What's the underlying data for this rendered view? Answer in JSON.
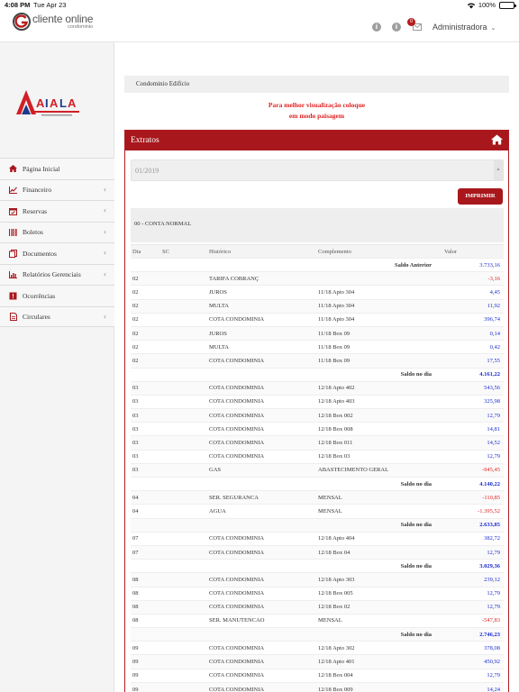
{
  "status": {
    "time": "4:08 PM",
    "date": "Tue Apr 23",
    "battery": "100%"
  },
  "header": {
    "brand": "cliente online",
    "brand_sub": "condominio",
    "notification_count": "0",
    "user": "Administradora"
  },
  "sidebar": {
    "items": [
      {
        "label": "Página Inicial",
        "icon": "home-icon"
      },
      {
        "label": "Financeiro",
        "icon": "chart-line-icon"
      },
      {
        "label": "Reservas",
        "icon": "calendar-icon"
      },
      {
        "label": "Boletos",
        "icon": "barcode-icon"
      },
      {
        "label": "Documentos",
        "icon": "documents-icon"
      },
      {
        "label": "Relatórios Gerenciais",
        "icon": "bar-chart-icon"
      },
      {
        "label": "Ocorrências",
        "icon": "warning-icon"
      },
      {
        "label": "Circulares",
        "icon": "file-icon"
      }
    ]
  },
  "main": {
    "breadcrumb": "Condominio Edifício",
    "notice_line1": "Para melhor visualização coloque",
    "notice_line2": "em modo paisagem",
    "panel_title": "Extratos",
    "period": "01/2019",
    "print_label": "IMPRIMIR",
    "account": "00 - CONTA NORMAL",
    "columns": {
      "dia": "Dia",
      "sc": "SC",
      "historico": "Histórico",
      "complemento": "Complemento",
      "valor": "Valor"
    },
    "saldo_anterior_label": "Saldo Anterior",
    "saldo_anterior_value": "3.733,16",
    "rows": [
      {
        "type": "entry",
        "dia": "02",
        "historico": "TARIFA COBRANÇ",
        "complemento": "",
        "valor": "-3,16",
        "neg": true
      },
      {
        "type": "entry",
        "dia": "02",
        "historico": "JUROS",
        "complemento": "11/18 Apto 304",
        "valor": "4,45",
        "neg": false
      },
      {
        "type": "entry",
        "dia": "02",
        "historico": "MULTA",
        "complemento": "11/18 Apto 304",
        "valor": "11,92",
        "neg": false
      },
      {
        "type": "entry",
        "dia": "02",
        "historico": "COTA CONDOMINIA",
        "complemento": "11/18 Apto 304",
        "valor": "396,74",
        "neg": false
      },
      {
        "type": "entry",
        "dia": "02",
        "historico": "JUROS",
        "complemento": "11/18 Box 09",
        "valor": "0,14",
        "neg": false
      },
      {
        "type": "entry",
        "dia": "02",
        "historico": "MULTA",
        "complemento": "11/18 Box 09",
        "valor": "0,42",
        "neg": false
      },
      {
        "type": "entry",
        "dia": "02",
        "historico": "COTA CONDOMINIA",
        "complemento": "11/18 Box 09",
        "valor": "17,55",
        "neg": false
      },
      {
        "type": "saldo",
        "label": "Saldo no dia",
        "valor": "4.161,22"
      },
      {
        "type": "entry",
        "dia": "03",
        "historico": "COTA CONDOMINIA",
        "complemento": "12/18 Apto 402",
        "valor": "543,56",
        "neg": false
      },
      {
        "type": "entry",
        "dia": "03",
        "historico": "COTA CONDOMINIA",
        "complemento": "12/18 Apto 403",
        "valor": "325,98",
        "neg": false
      },
      {
        "type": "entry",
        "dia": "03",
        "historico": "COTA CONDOMINIA",
        "complemento": "12/18 Box 002",
        "valor": "12,79",
        "neg": false
      },
      {
        "type": "entry",
        "dia": "03",
        "historico": "COTA CONDOMINIA",
        "complemento": "12/18 Box 008",
        "valor": "14,81",
        "neg": false
      },
      {
        "type": "entry",
        "dia": "03",
        "historico": "COTA CONDOMINIA",
        "complemento": "12/18 Box 011",
        "valor": "14,52",
        "neg": false
      },
      {
        "type": "entry",
        "dia": "03",
        "historico": "COTA CONDOMINIA",
        "complemento": "12/18 Box 03",
        "valor": "12,79",
        "neg": false
      },
      {
        "type": "entry",
        "dia": "03",
        "historico": "GAS",
        "complemento": "ABASTECIMENTO GERAL",
        "valor": "-945,45",
        "neg": true
      },
      {
        "type": "saldo",
        "label": "Saldo no dia",
        "valor": "4.140,22"
      },
      {
        "type": "entry",
        "dia": "04",
        "historico": "SER. SEGURANCA",
        "complemento": "MENSAL",
        "valor": "-110,85",
        "neg": true
      },
      {
        "type": "entry",
        "dia": "04",
        "historico": "AGUA",
        "complemento": "MENSAL",
        "valor": "-1.395,52",
        "neg": true
      },
      {
        "type": "saldo",
        "label": "Saldo no dia",
        "valor": "2.633,85"
      },
      {
        "type": "entry",
        "dia": "07",
        "historico": "COTA CONDOMINIA",
        "complemento": "12/18 Apto 404",
        "valor": "382,72",
        "neg": false
      },
      {
        "type": "entry",
        "dia": "07",
        "historico": "COTA CONDOMINIA",
        "complemento": "12/18 Box 04",
        "valor": "12,79",
        "neg": false
      },
      {
        "type": "saldo",
        "label": "Saldo no dia",
        "valor": "3.029,36"
      },
      {
        "type": "entry",
        "dia": "08",
        "historico": "COTA CONDOMINIA",
        "complemento": "12/18 Apto 303",
        "valor": "239,12",
        "neg": false
      },
      {
        "type": "entry",
        "dia": "08",
        "historico": "COTA CONDOMINIA",
        "complemento": "12/18 Box 005",
        "valor": "12,79",
        "neg": false
      },
      {
        "type": "entry",
        "dia": "08",
        "historico": "COTA CONDOMINIA",
        "complemento": "12/18 Box 02",
        "valor": "12,79",
        "neg": false
      },
      {
        "type": "entry",
        "dia": "08",
        "historico": "SER. MANUTENCAO",
        "complemento": "MENSAL",
        "valor": "-547,83",
        "neg": true
      },
      {
        "type": "saldo",
        "label": "Saldo no dia",
        "valor": "2.746,23"
      },
      {
        "type": "entry",
        "dia": "09",
        "historico": "COTA CONDOMINIA",
        "complemento": "12/18 Apto 302",
        "valor": "378,08",
        "neg": false
      },
      {
        "type": "entry",
        "dia": "09",
        "historico": "COTA CONDOMINIA",
        "complemento": "12/18 Apto 401",
        "valor": "450,92",
        "neg": false
      },
      {
        "type": "entry",
        "dia": "09",
        "historico": "COTA CONDOMINIA",
        "complemento": "12/18 Box 004",
        "valor": "12,79",
        "neg": false
      },
      {
        "type": "entry",
        "dia": "09",
        "historico": "COTA CONDOMINIA",
        "complemento": "12/18 Box 009",
        "valor": "14,24",
        "neg": false
      }
    ]
  },
  "colors": {
    "brand_red": "#a8171c",
    "positive": "#1a2bd0",
    "negative": "#e02020"
  }
}
